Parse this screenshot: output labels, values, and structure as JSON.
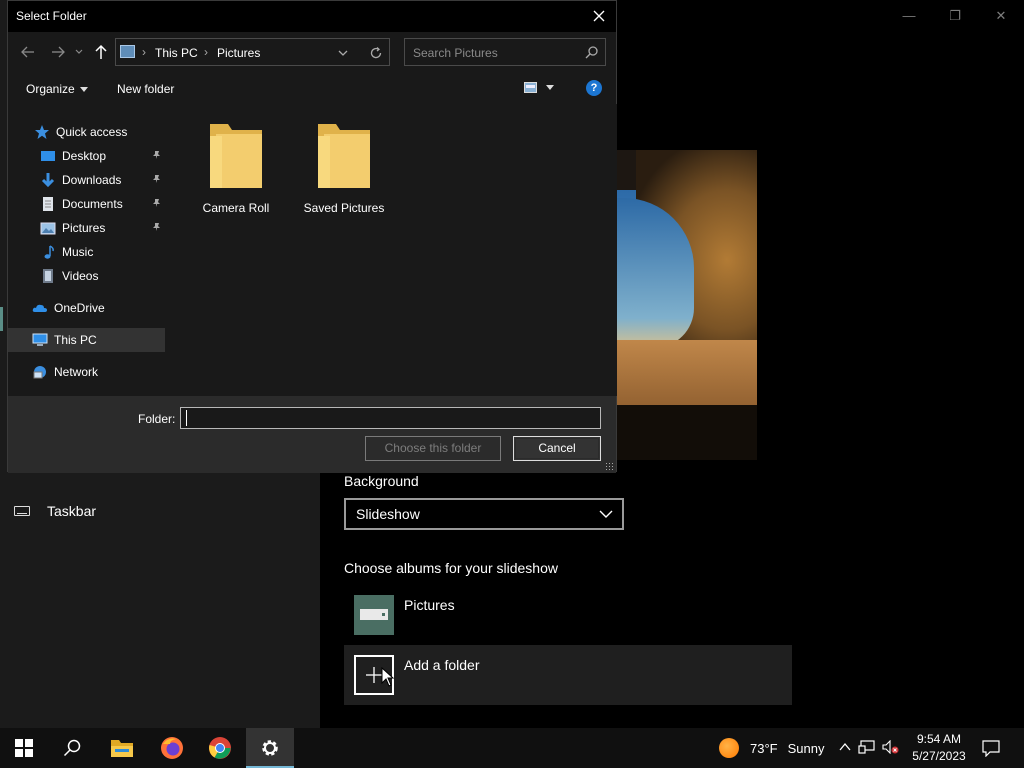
{
  "dialog": {
    "title": "Select Folder",
    "address": {
      "crumbs": [
        "This PC",
        "Pictures"
      ]
    },
    "search_placeholder": "Search Pictures",
    "toolbar": {
      "organize": "Organize",
      "new_folder": "New folder"
    },
    "nav": [
      {
        "label": "Quick access",
        "icon": "star-icon",
        "pinned": false
      },
      {
        "label": "Desktop",
        "icon": "desktop-icon",
        "pinned": true
      },
      {
        "label": "Downloads",
        "icon": "download-icon",
        "pinned": true
      },
      {
        "label": "Documents",
        "icon": "documents-icon",
        "pinned": true
      },
      {
        "label": "Pictures",
        "icon": "pictures-icon",
        "pinned": true
      },
      {
        "label": "Music",
        "icon": "music-icon",
        "pinned": false
      },
      {
        "label": "Videos",
        "icon": "videos-icon",
        "pinned": false
      },
      {
        "label": "OneDrive",
        "icon": "cloud-icon",
        "pinned": false
      },
      {
        "label": "This PC",
        "icon": "computer-icon",
        "pinned": false,
        "selected": true
      },
      {
        "label": "Network",
        "icon": "network-icon",
        "pinned": false
      }
    ],
    "folders": [
      "Camera Roll",
      "Saved Pictures"
    ],
    "folder_label": "Folder:",
    "folder_value": "",
    "choose_button": "Choose this folder",
    "cancel_button": "Cancel"
  },
  "settings": {
    "nav_taskbar": "Taskbar",
    "background_label": "Background",
    "background_value": "Slideshow",
    "albums_label": "Choose albums for your slideshow",
    "album_name": "Pictures",
    "add_folder": "Add a folder"
  },
  "taskbar": {
    "apps": [
      "start-icon",
      "search-icon",
      "file-explorer-icon",
      "firefox-icon",
      "chrome-icon",
      "settings-icon"
    ],
    "weather": {
      "temp": "73°F",
      "condition": "Sunny"
    },
    "time": "9:54 AM",
    "date": "5/27/2023"
  },
  "colors": {
    "accent": "#5a8e87",
    "folder": "#f3cd6e",
    "help": "#1c76d2",
    "selected_nav": "#333333"
  }
}
